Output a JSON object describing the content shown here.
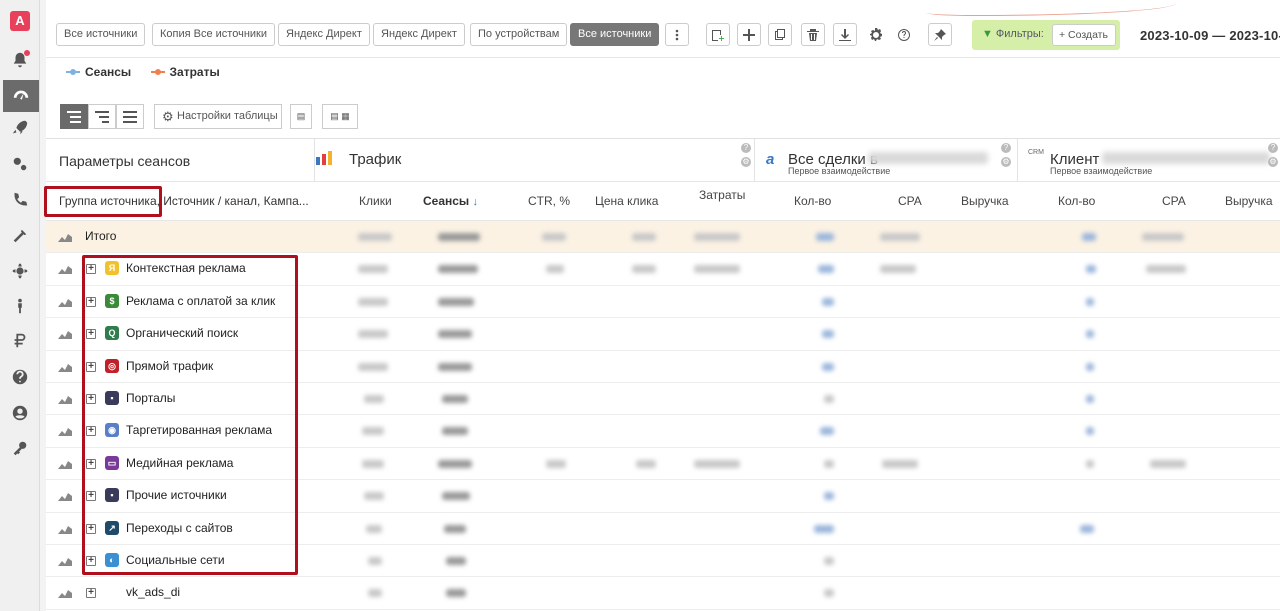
{
  "rail": {
    "logo": "A",
    "icons": [
      "notifications-icon",
      "dashboard-icon",
      "rocket-icon",
      "integrations-icon",
      "phone-icon",
      "tools-icon",
      "settings-icon",
      "user-actions-icon",
      "ruble-icon",
      "help-icon",
      "account-icon",
      "key-icon"
    ]
  },
  "toolbar": {
    "presets": [
      "Все источники",
      "Копия Все источники",
      "Яндекс Директ",
      "Яндекс Директ",
      "По устройствам",
      "Все источники"
    ],
    "filters_label": "Фильтры:",
    "create_label": "+ Создать",
    "date_range": "2023-10-09 — 2023-10-"
  },
  "legend": [
    {
      "label": "Сеансы",
      "color": "#7fb2e0"
    },
    {
      "label": "Затраты",
      "color": "#f08050"
    }
  ],
  "table_tools": {
    "settings_label": "Настройки таблицы"
  },
  "table": {
    "params_title": "Параметры сеансов",
    "traffic_title": "Трафик",
    "deals_title": "Все сделки в",
    "deals_sub": "Первое взаимодействие",
    "client_title": "Клиент",
    "client_sub": "Первое взаимодействие",
    "dimension_header": "Группа источника, Источник / канал, Кампа...",
    "columns": [
      "Клики",
      "Сеансы",
      "CTR, %",
      "Цена клика",
      "Затраты",
      "Кол-во",
      "CPA",
      "Выручка",
      "Кол-во",
      "CPA",
      "Выручка"
    ],
    "sort_arrow": "↓",
    "total_label": "Итого",
    "rows": [
      {
        "label": "Контекстная реклама",
        "icon_color": "#f2c12e",
        "glyph": "Я"
      },
      {
        "label": "Реклама с оплатой за клик",
        "icon_color": "#3a8a3a",
        "glyph": "$"
      },
      {
        "label": "Органический поиск",
        "icon_color": "#2f7d4c",
        "glyph": "Q"
      },
      {
        "label": "Прямой трафик",
        "icon_color": "#c0202a",
        "glyph": "◎"
      },
      {
        "label": "Порталы",
        "icon_color": "#3a3a5a",
        "glyph": "▪"
      },
      {
        "label": "Таргетированная реклама",
        "icon_color": "#5a7fc8",
        "glyph": "◉"
      },
      {
        "label": "Медийная реклама",
        "icon_color": "#7a3a9a",
        "glyph": "▭"
      },
      {
        "label": "Прочие источники",
        "icon_color": "#3a3a5a",
        "glyph": "▪"
      },
      {
        "label": "Переходы с сайтов",
        "icon_color": "#1f4a6a",
        "glyph": "↗"
      },
      {
        "label": "Социальные сети",
        "icon_color": "#3a90d0",
        "glyph": "◐"
      },
      {
        "label": "vk_ads_di",
        "icon_color": "",
        "glyph": ""
      }
    ]
  }
}
